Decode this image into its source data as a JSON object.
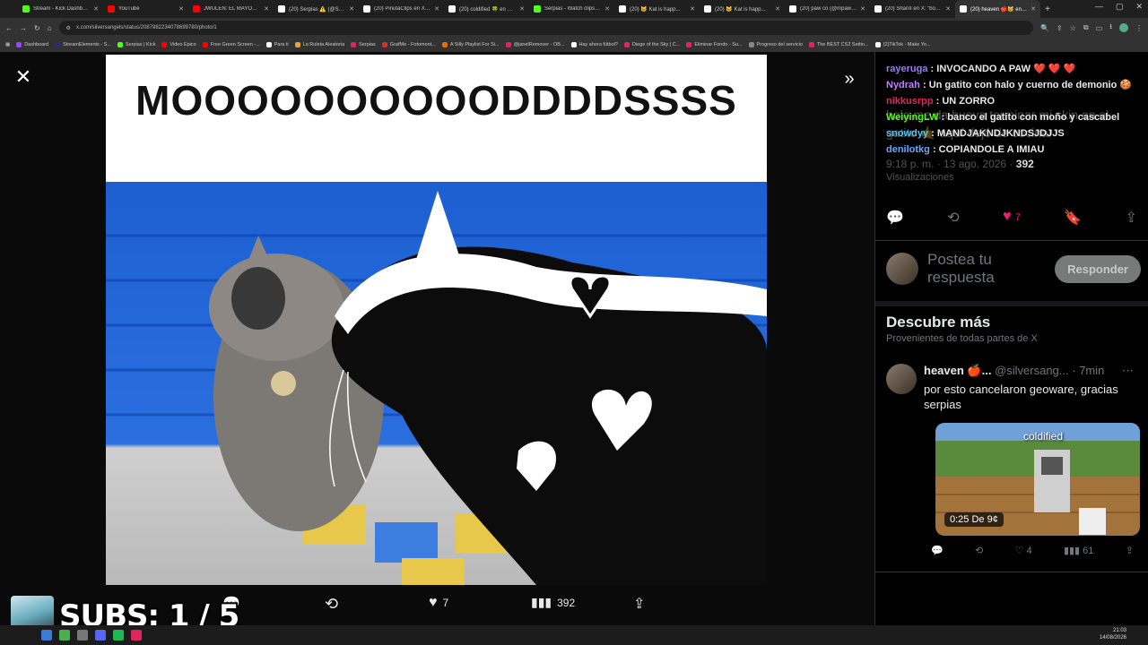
{
  "browser": {
    "tabs": [
      {
        "title": "Stream - Kick Dashboard",
        "color": "#53fc18"
      },
      {
        "title": "YouTube",
        "color": "#ff0000"
      },
      {
        "title": "JWULEN: EL MAYOR FR...",
        "color": "#ff0000"
      },
      {
        "title": "(20) Serpias ⚠️ (@Serp...",
        "color": "#ffffff"
      },
      {
        "title": "(20) PinutaClips en X: \"...",
        "color": "#ffffff"
      },
      {
        "title": "(20) coldified 🍀 en X:...",
        "color": "#ffffff"
      },
      {
        "title": "Serpias - Watch clips o...",
        "color": "#53fc18"
      },
      {
        "title": "(20) 🐱 Kat is happ...",
        "color": "#ffffff"
      },
      {
        "title": "(20) 🐱 Kat is happ...",
        "color": "#ffffff"
      },
      {
        "title": "(20) paw co (@mpawc...",
        "color": "#ffffff"
      },
      {
        "title": "(20) ShanII en X: \"boca...",
        "color": "#ffffff"
      },
      {
        "title": "(20) heaven 🍎🐱 en X...",
        "color": "#ffffff"
      }
    ],
    "active_tab": 11,
    "url": "x.com/silversangels/status/2087982234078699780/photo/1",
    "bookmarks": [
      {
        "label": "Dashboard",
        "color": "#9146ff"
      },
      {
        "label": "StreamElements - S...",
        "color": "#2b2b7a"
      },
      {
        "label": "Serpias | Kick",
        "color": "#53fc18"
      },
      {
        "label": "Video Epico",
        "color": "#ff0000"
      },
      {
        "label": "Free Green Screen -...",
        "color": "#ff0000"
      },
      {
        "label": "Para ti",
        "color": "#ffffff"
      },
      {
        "label": "La Ruleta Aleatoria",
        "color": "#f0a030"
      },
      {
        "label": "Serpias",
        "color": "#e0245e"
      },
      {
        "label": "GrafMe - Fotomont...",
        "color": "#cc3333"
      },
      {
        "label": "A Silly Playlist For Si...",
        "color": "#e07000"
      },
      {
        "label": "@janelRemover - OB...",
        "color": "#e0245e"
      },
      {
        "label": "Hay ahora fútbol?",
        "color": "#ffffff"
      },
      {
        "label": "Diege of the Sky | C...",
        "color": "#e0245e"
      },
      {
        "label": "Eliminar Fondo - Su...",
        "color": "#e0245e"
      },
      {
        "label": "Progreso del servicio",
        "color": "#888888"
      },
      {
        "label": "The BEST CS2 Settin...",
        "color": "#e0245e"
      },
      {
        "label": "(2)TikTok - Make Yo...",
        "color": "#ffffff"
      }
    ]
  },
  "viewer": {
    "caption": "MOOOOOOOOOODDDDSSSS",
    "replies": "",
    "reposts": "",
    "likes": "7",
    "views": "392"
  },
  "chat": [
    {
      "user": "rayeruga",
      "text": "INVOCANDO A PAW ❤️ ❤️ ❤️",
      "color": "#9b7cf0"
    },
    {
      "user": "Nydrah",
      "text": "Un gatito con halo y cuerno de demonio 🍪",
      "color": "#c77dff"
    },
    {
      "user": "nikkusrpp",
      "text": "UN ZORRO",
      "color": "#e0245e"
    },
    {
      "user": "WeiyingLW",
      "text": "banco el gatito con moño y cascabel",
      "color": "#53fc18"
    },
    {
      "user": "snowdyy",
      "text": "MANDJAKNDJKNDSJDJJS",
      "color": "#4fc3f7"
    },
    {
      "user": "denilotkg",
      "text": "COPIANDOLE A IMIAU",
      "color": "#6aa8ff"
    }
  ],
  "ghost_text": {
    "line1": "hola me da hueva terminar mi skin en el",
    "line2": "gatito 🤙 aquí dejó de cocinar",
    "meta": "9:18 p. m. · 13 ago. 2026 ·",
    "views": "392",
    "views_label": "Visualizaciones"
  },
  "tweet_actions": {
    "likes": "7"
  },
  "reply": {
    "placeholder": "Postea tu respuesta",
    "button": "Responder"
  },
  "discover": {
    "title": "Descubre más",
    "subtitle": "Provenientes de todas partes de X",
    "post": {
      "name": "heaven 🍎...",
      "handle": "@silversang...",
      "time": "· 7min",
      "text": "por esto cancelaron geoware, gracias serpias",
      "video_label": "coldified",
      "duration": "0:25",
      "from_label": "De",
      "from_handle": "9¢",
      "replies": "",
      "reposts": "",
      "likes": "4",
      "views": "61"
    }
  },
  "overlay": {
    "subs": "SUBS: 1 / 5"
  },
  "clock": {
    "time": "21:03",
    "date": "14/08/2026"
  }
}
